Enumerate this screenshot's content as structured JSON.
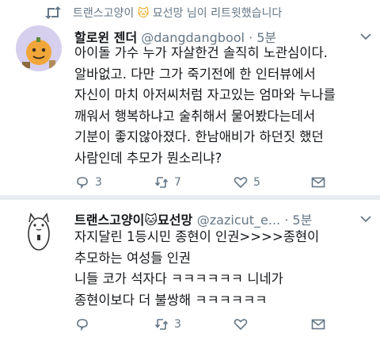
{
  "retweet_notice": {
    "prefix": "트랜스고양이",
    "emoji": "🐱",
    "suffix": "묘선망 님이 리트윗했습니다"
  },
  "tweets": [
    {
      "display_name": "할로윈 젠더",
      "handle": "@dangdangbool",
      "time": "· 5분",
      "lines": [
        "아이돌 가수 누가 자살한건 솔직히 노관심이다.",
        "알바없고. 다만 그가 죽기전에 한 인터뷰에서",
        "자신이 마치 아저씨처럼 자고있는 엄마와 누나를",
        "깨워서 행복하냐고 술취해서 물어봤다는데서",
        "기분이 좋지않아졌다. 한남애비가 하던짓 했던",
        "사람인데 추모가 뭔소리냐?"
      ],
      "replies": "3",
      "retweets": "7",
      "likes": "5"
    },
    {
      "display_name": "트랜스고양이",
      "emoji": "🐱",
      "display_name_suffix": "묘선망",
      "handle": "@zazicut_e...",
      "time": "· 5분",
      "lines": [
        "자지달린 1등시민 종현이 인권>>>>종현이",
        "추모하는 여성들 인권",
        "니들 코가 석자다 ㅋㅋㅋㅋㅋㅋ 니네가",
        "종현이보다 더 불쌍해 ㅋㅋㅋㅋㅋㅋ"
      ],
      "replies": "",
      "retweets": "3",
      "likes": ""
    }
  ],
  "icons": {
    "retweet_notice": "retweet-icon",
    "menu": "chevron-down-icon",
    "reply": "reply-icon",
    "retweet": "retweet-icon",
    "like": "heart-icon",
    "dm": "envelope-icon"
  },
  "colors": {
    "text": "#14171a",
    "secondary": "#657786",
    "divider": "#e6ecf0"
  }
}
